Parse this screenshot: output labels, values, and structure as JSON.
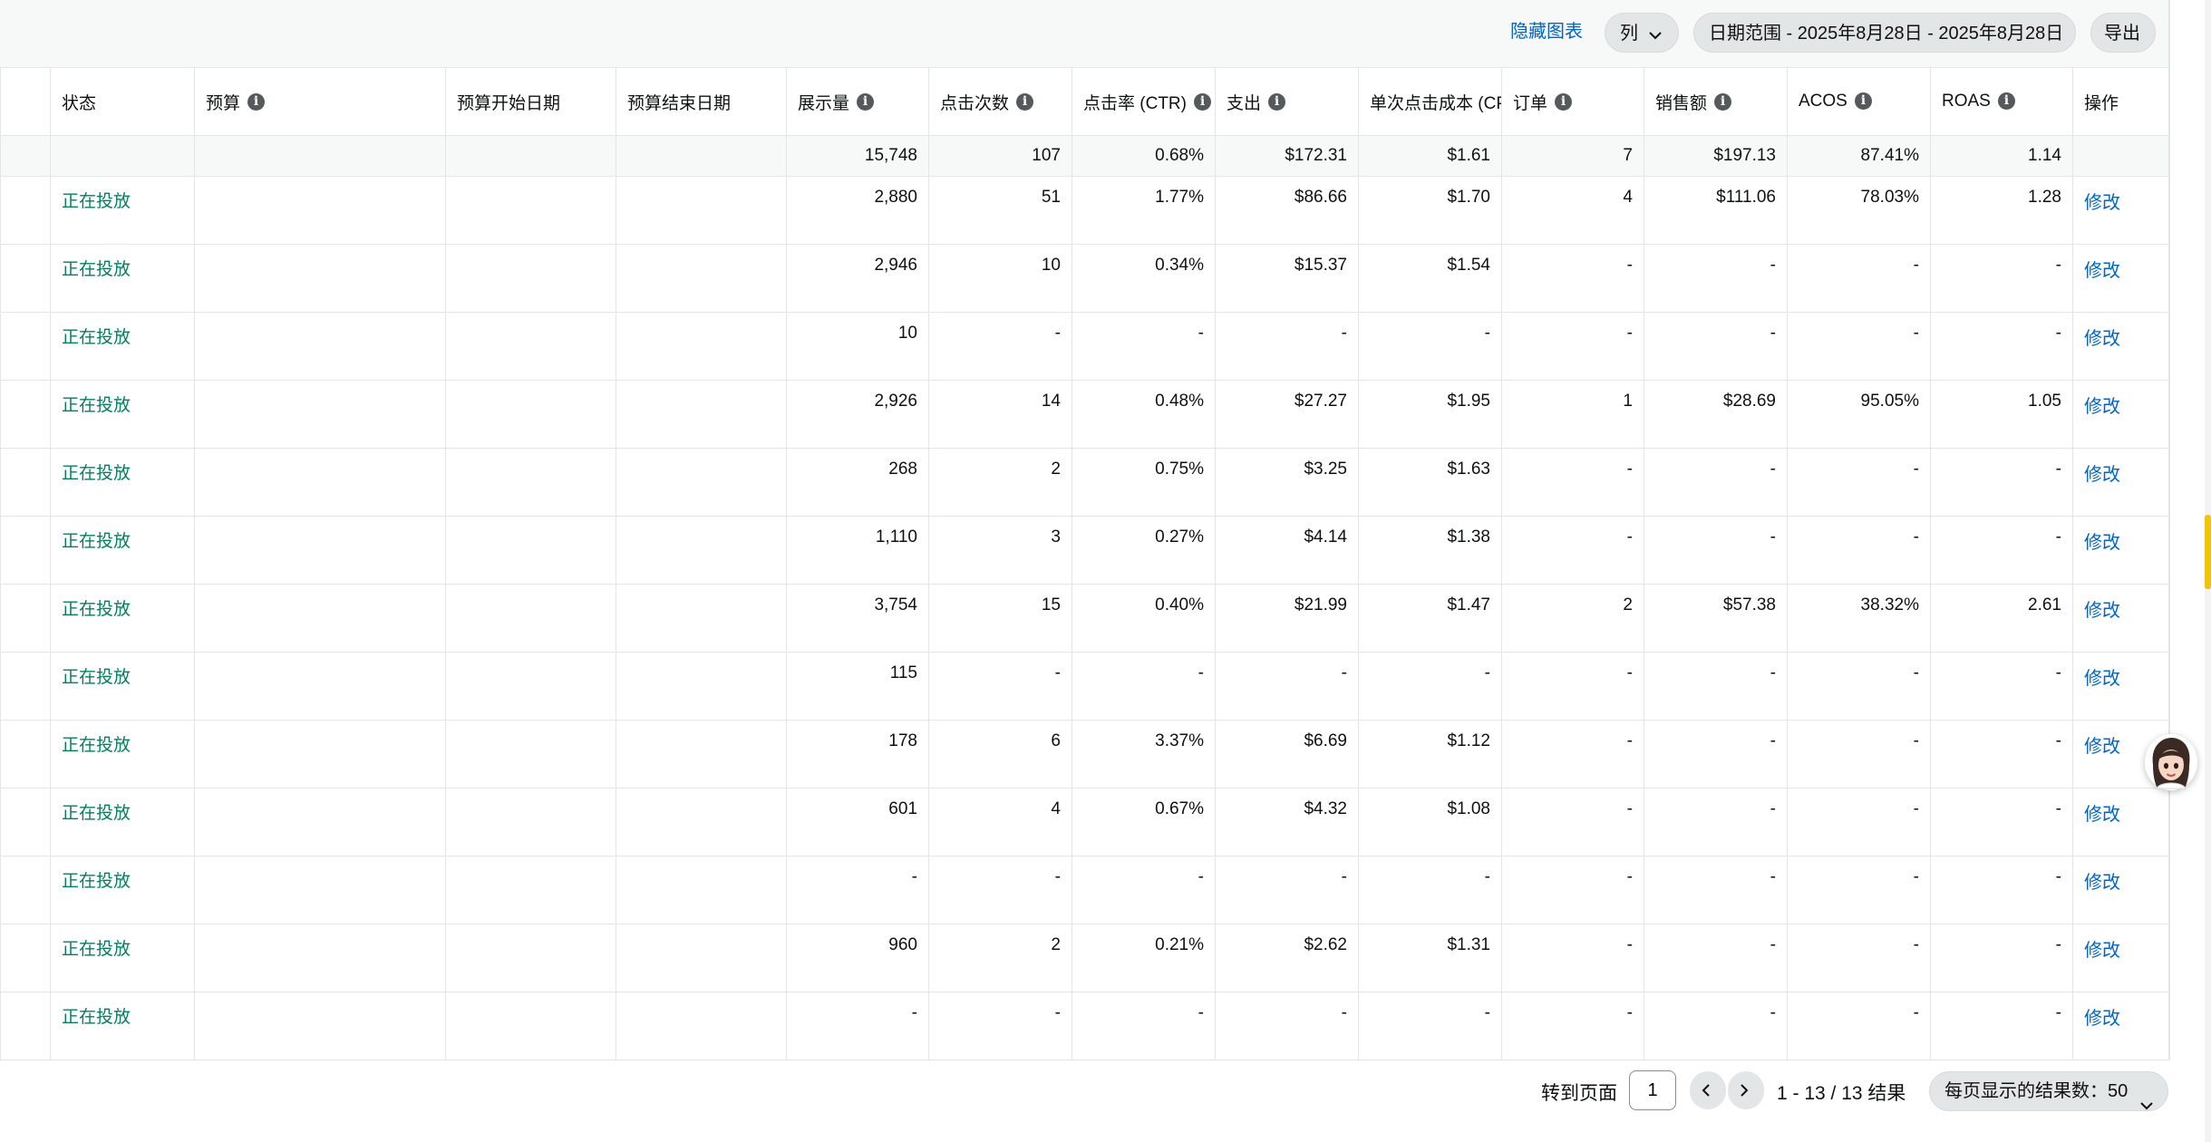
{
  "toolbar": {
    "hide_chart": "隐藏图表",
    "columns": "列",
    "date_range": "日期范围 - 2025年8月28日 - 2025年8月28日",
    "export": "导出"
  },
  "table": {
    "headers": [
      "",
      "状态",
      "预算",
      "预算开始日期",
      "预算结束日期",
      "展示量",
      "点击次数",
      "点击率 (CTR)",
      "支出",
      "单次点击成本 (CPC)",
      "订单",
      "销售额",
      "ACOS",
      "ROAS",
      "操作"
    ],
    "summary": [
      "",
      "",
      "",
      "",
      "",
      "15,748",
      "107",
      "0.68%",
      "$172.31",
      "$1.61",
      "7",
      "$197.13",
      "87.41%",
      "1.14",
      ""
    ],
    "rows": [
      {
        "status": "正在投放",
        "impressions": "2,880",
        "clicks": "51",
        "ctr": "1.77%",
        "spend": "$86.66",
        "cpc": "$1.70",
        "orders": "4",
        "sales": "$111.06",
        "acos": "78.03%",
        "roas": "1.28",
        "action": "修改"
      },
      {
        "status": "正在投放",
        "impressions": "2,946",
        "clicks": "10",
        "ctr": "0.34%",
        "spend": "$15.37",
        "cpc": "$1.54",
        "orders": "-",
        "sales": "-",
        "acos": "-",
        "roas": "-",
        "action": "修改"
      },
      {
        "status": "正在投放",
        "impressions": "10",
        "clicks": "-",
        "ctr": "-",
        "spend": "-",
        "cpc": "-",
        "orders": "-",
        "sales": "-",
        "acos": "-",
        "roas": "-",
        "action": "修改"
      },
      {
        "status": "正在投放",
        "impressions": "2,926",
        "clicks": "14",
        "ctr": "0.48%",
        "spend": "$27.27",
        "cpc": "$1.95",
        "orders": "1",
        "sales": "$28.69",
        "acos": "95.05%",
        "roas": "1.05",
        "action": "修改"
      },
      {
        "status": "正在投放",
        "impressions": "268",
        "clicks": "2",
        "ctr": "0.75%",
        "spend": "$3.25",
        "cpc": "$1.63",
        "orders": "-",
        "sales": "-",
        "acos": "-",
        "roas": "-",
        "action": "修改"
      },
      {
        "status": "正在投放",
        "impressions": "1,110",
        "clicks": "3",
        "ctr": "0.27%",
        "spend": "$4.14",
        "cpc": "$1.38",
        "orders": "-",
        "sales": "-",
        "acos": "-",
        "roas": "-",
        "action": "修改"
      },
      {
        "status": "正在投放",
        "impressions": "3,754",
        "clicks": "15",
        "ctr": "0.40%",
        "spend": "$21.99",
        "cpc": "$1.47",
        "orders": "2",
        "sales": "$57.38",
        "acos": "38.32%",
        "roas": "2.61",
        "action": "修改"
      },
      {
        "status": "正在投放",
        "impressions": "115",
        "clicks": "-",
        "ctr": "-",
        "spend": "-",
        "cpc": "-",
        "orders": "-",
        "sales": "-",
        "acos": "-",
        "roas": "-",
        "action": "修改"
      },
      {
        "status": "正在投放",
        "impressions": "178",
        "clicks": "6",
        "ctr": "3.37%",
        "spend": "$6.69",
        "cpc": "$1.12",
        "orders": "-",
        "sales": "-",
        "acos": "-",
        "roas": "-",
        "action": "修改"
      },
      {
        "status": "正在投放",
        "impressions": "601",
        "clicks": "4",
        "ctr": "0.67%",
        "spend": "$4.32",
        "cpc": "$1.08",
        "orders": "-",
        "sales": "-",
        "acos": "-",
        "roas": "-",
        "action": "修改"
      },
      {
        "status": "正在投放",
        "impressions": "-",
        "clicks": "-",
        "ctr": "-",
        "spend": "-",
        "cpc": "-",
        "orders": "-",
        "sales": "-",
        "acos": "-",
        "roas": "-",
        "action": "修改"
      },
      {
        "status": "正在投放",
        "impressions": "960",
        "clicks": "2",
        "ctr": "0.21%",
        "spend": "$2.62",
        "cpc": "$1.31",
        "orders": "-",
        "sales": "-",
        "acos": "-",
        "roas": "-",
        "action": "修改"
      },
      {
        "status": "正在投放",
        "impressions": "-",
        "clicks": "-",
        "ctr": "-",
        "spend": "-",
        "cpc": "-",
        "orders": "-",
        "sales": "-",
        "acos": "-",
        "roas": "-",
        "action": "修改"
      }
    ]
  },
  "footer": {
    "goto_label": "转到页面",
    "page_value": "1",
    "results": "1 - 13 / 13 结果",
    "per_page": "每页显示的结果数：50"
  },
  "colors": {
    "status_green": "#067d62",
    "link_blue": "#0066c0",
    "pill_bg": "#e3e6e6"
  }
}
